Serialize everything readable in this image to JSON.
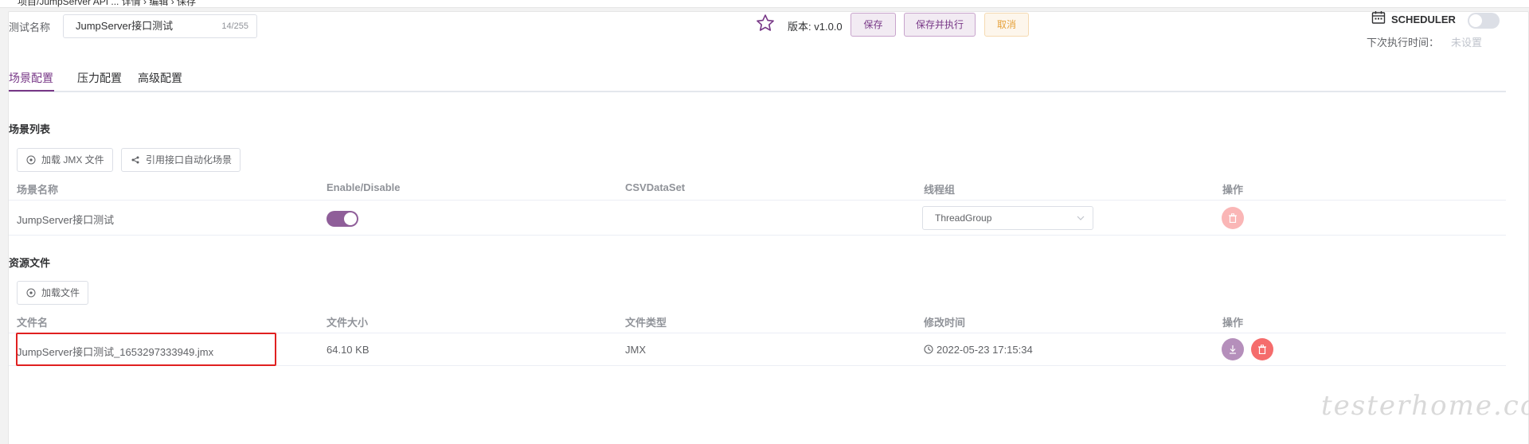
{
  "breadcrumb": "项目/JumpServer API ... 详情 › 编辑 › 保存",
  "header": {
    "name_label": "测试名称",
    "name_value": "JumpServer接口测试",
    "name_count": "14/255",
    "version": "版本: v1.0.0",
    "save": "保存",
    "save_run": "保存并执行",
    "cancel": "取消",
    "scheduler_label": "SCHEDULER",
    "scheduler_enabled": false,
    "next_label": "下次执行时间：",
    "next_value": "未设置"
  },
  "tabs": [
    {
      "label": "场景配置",
      "active": true
    },
    {
      "label": "压力配置",
      "active": false
    },
    {
      "label": "高级配置",
      "active": false
    }
  ],
  "scenarios": {
    "title": "场景列表",
    "load_jmx": "加载 JMX 文件",
    "ref_api": "引用接口自动化场景",
    "columns": [
      "场景名称",
      "Enable/Disable",
      "CSVDataSet",
      "线程组",
      "操作"
    ],
    "rows": [
      {
        "name": "JumpServer接口测试",
        "enabled": true,
        "csv": "",
        "thread_group": "ThreadGroup"
      }
    ]
  },
  "resources": {
    "title": "资源文件",
    "load_file": "加载文件",
    "columns": [
      "文件名",
      "文件大小",
      "文件类型",
      "修改时间",
      "操作"
    ],
    "rows": [
      {
        "name": "JumpServer接口测试_1653297333949.jmx",
        "size": "64.10 KB",
        "type": "JMX",
        "modified": "2022-05-23 17:15:34"
      }
    ]
  },
  "watermark": "testerhome.com",
  "colors": {
    "primary": "#783887",
    "switch_on": "#8f5e99",
    "danger": "#f56c6c",
    "danger_light": "#fab6b6",
    "download": "#b58fbb",
    "warning": "#e6a23c",
    "highlight": "#e02020"
  }
}
